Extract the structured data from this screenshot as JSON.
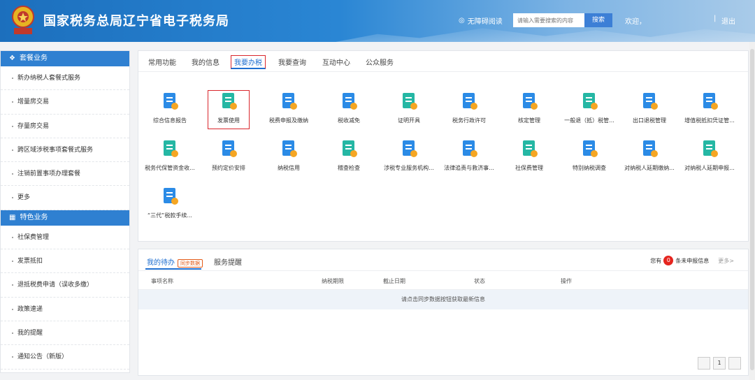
{
  "header": {
    "site_title": "国家税务总局辽宁省电子税务局",
    "accessible_label": "无障碍阅读",
    "search_placeholder": "请输入需要搜索的内容",
    "search_button": "搜索",
    "welcome_text": "欢迎，",
    "separator": "|",
    "logout": "退出"
  },
  "sidebar": {
    "section1_title": "套餐业务",
    "section1_items": [
      "新办纳税人套餐式服务",
      "增量房交易",
      "存量房交易",
      "跨区域涉税事项套餐式服务",
      "注销前置事项办理套餐",
      "更多"
    ],
    "section2_title": "特色业务",
    "section2_items": [
      "社保费管理",
      "发票抵扣",
      "退抵税费申请（误收多缴）",
      "政策速递",
      "我的提醒",
      "通知公告（新版）"
    ]
  },
  "tabs": [
    "常用功能",
    "我的信息",
    "我要办税",
    "我要查询",
    "互动中心",
    "公众服务"
  ],
  "grid": {
    "row1": [
      "综合信息报告",
      "发票使用",
      "税费申报及缴纳",
      "税收减免",
      "证明开具",
      "税务行政许可",
      "核定管理",
      "一般退（抵）税管...",
      "出口退税管理",
      "增值税抵扣凭证管..."
    ],
    "row2": [
      "税务代保管资金收...",
      "预约定价安排",
      "纳税信用",
      "稽查检查",
      "涉税专业服务机构...",
      "法律追责与救济事...",
      "社保费管理",
      "特别纳税调查",
      "对纳税人延期缴纳...",
      "对纳税人延期申报..."
    ],
    "row3": [
      "“三代”税款手续..."
    ]
  },
  "bottom": {
    "tab_todo": "我的待办",
    "sync_badge": "同步数据",
    "tab_reminder": "服务提醒",
    "notice_prefix": "您有",
    "notice_count": "0",
    "notice_suffix": "条未申报信息",
    "more": "更多>",
    "columns": [
      "事项名称",
      "纳税期限",
      "截止日期",
      "状态",
      "操作"
    ],
    "empty_message": "请点击同步数据按钮获取最新信息",
    "page": "1"
  },
  "colors": {
    "primary": "#2f80d1",
    "highlight_red": "#d9262c",
    "icon_blue": "#2b8be6",
    "icon_green": "#25b7a4"
  }
}
